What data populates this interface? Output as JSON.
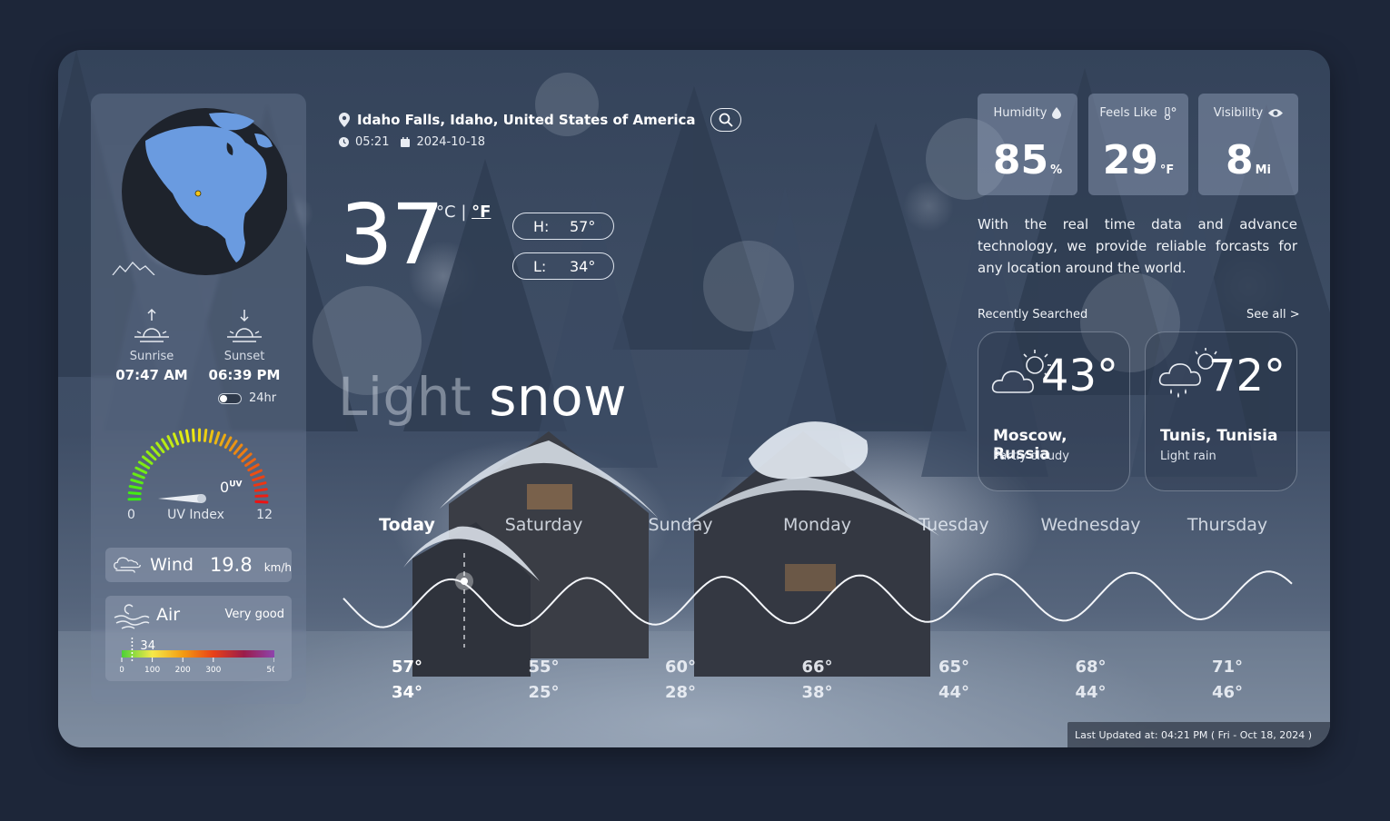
{
  "location": {
    "place": "Idaho Falls, Idaho, United States of America",
    "time": "05:21",
    "date": "2024-10-18"
  },
  "current": {
    "temperature": "37",
    "unit_c": "°C",
    "unit_sep": "|",
    "unit_f": "°F",
    "high_label": "H:",
    "high_value": "57°",
    "low_label": "L:",
    "low_value": "34°",
    "condition_word1": "Light",
    "condition_word2": "snow"
  },
  "sun": {
    "sunrise_label": "Sunrise",
    "sunrise_time": "07:47 AM",
    "sunset_label": "Sunset",
    "sunset_time": "06:39 PM",
    "toggle_label": "24hr"
  },
  "uv": {
    "value": "0",
    "unit": "UV",
    "label": "UV Index",
    "min": "0",
    "max": "12",
    "level": 0
  },
  "wind": {
    "label": "Wind",
    "value": "19.8",
    "unit": "km/h"
  },
  "air": {
    "label": "Air",
    "status": "Very good",
    "value": "34",
    "ticks": [
      "0",
      "100",
      "200",
      "300",
      "500"
    ]
  },
  "stats": {
    "humidity": {
      "title": "Humidity",
      "value": "85",
      "unit": "%"
    },
    "feels_like": {
      "title": "Feels Like",
      "value": "29",
      "unit": "°F"
    },
    "visibility": {
      "title": "Visibility",
      "value": "8",
      "unit": "Mi"
    }
  },
  "blurb": "With the real time data and advance technology, we provide reliable forcasts for any location around the world.",
  "recent": {
    "title": "Recently Searched",
    "see_all": "See all >",
    "cities": [
      {
        "name": "Moscow, Russia",
        "desc": "Partly cloudy",
        "temp": "43°",
        "icon": "partly-cloudy-icon"
      },
      {
        "name": "Tunis, Tunisia",
        "desc": "Light rain",
        "temp": "72°",
        "icon": "light-rain-icon"
      }
    ]
  },
  "forecast": {
    "days": [
      {
        "name": "Today",
        "hi": "57°",
        "lo": "34°",
        "active": true
      },
      {
        "name": "Saturday",
        "hi": "55°",
        "lo": "25°"
      },
      {
        "name": "Sunday",
        "hi": "60°",
        "lo": "28°"
      },
      {
        "name": "Monday",
        "hi": "66°",
        "lo": "38°"
      },
      {
        "name": "Tuesday",
        "hi": "65°",
        "lo": "44°"
      },
      {
        "name": "Wednesday",
        "hi": "68°",
        "lo": "44°"
      },
      {
        "name": "Thursday",
        "hi": "71°",
        "lo": "46°"
      }
    ]
  },
  "last_updated": "Last Updated at: 04:21 PM ( Fri - Oct 18, 2024 )",
  "colors": {
    "page_bg": "#1d2639",
    "uv_low": "#4cd137",
    "uv_high": "#e84118",
    "air_good": "#4cd137",
    "air_bad": "#8e44ad"
  }
}
